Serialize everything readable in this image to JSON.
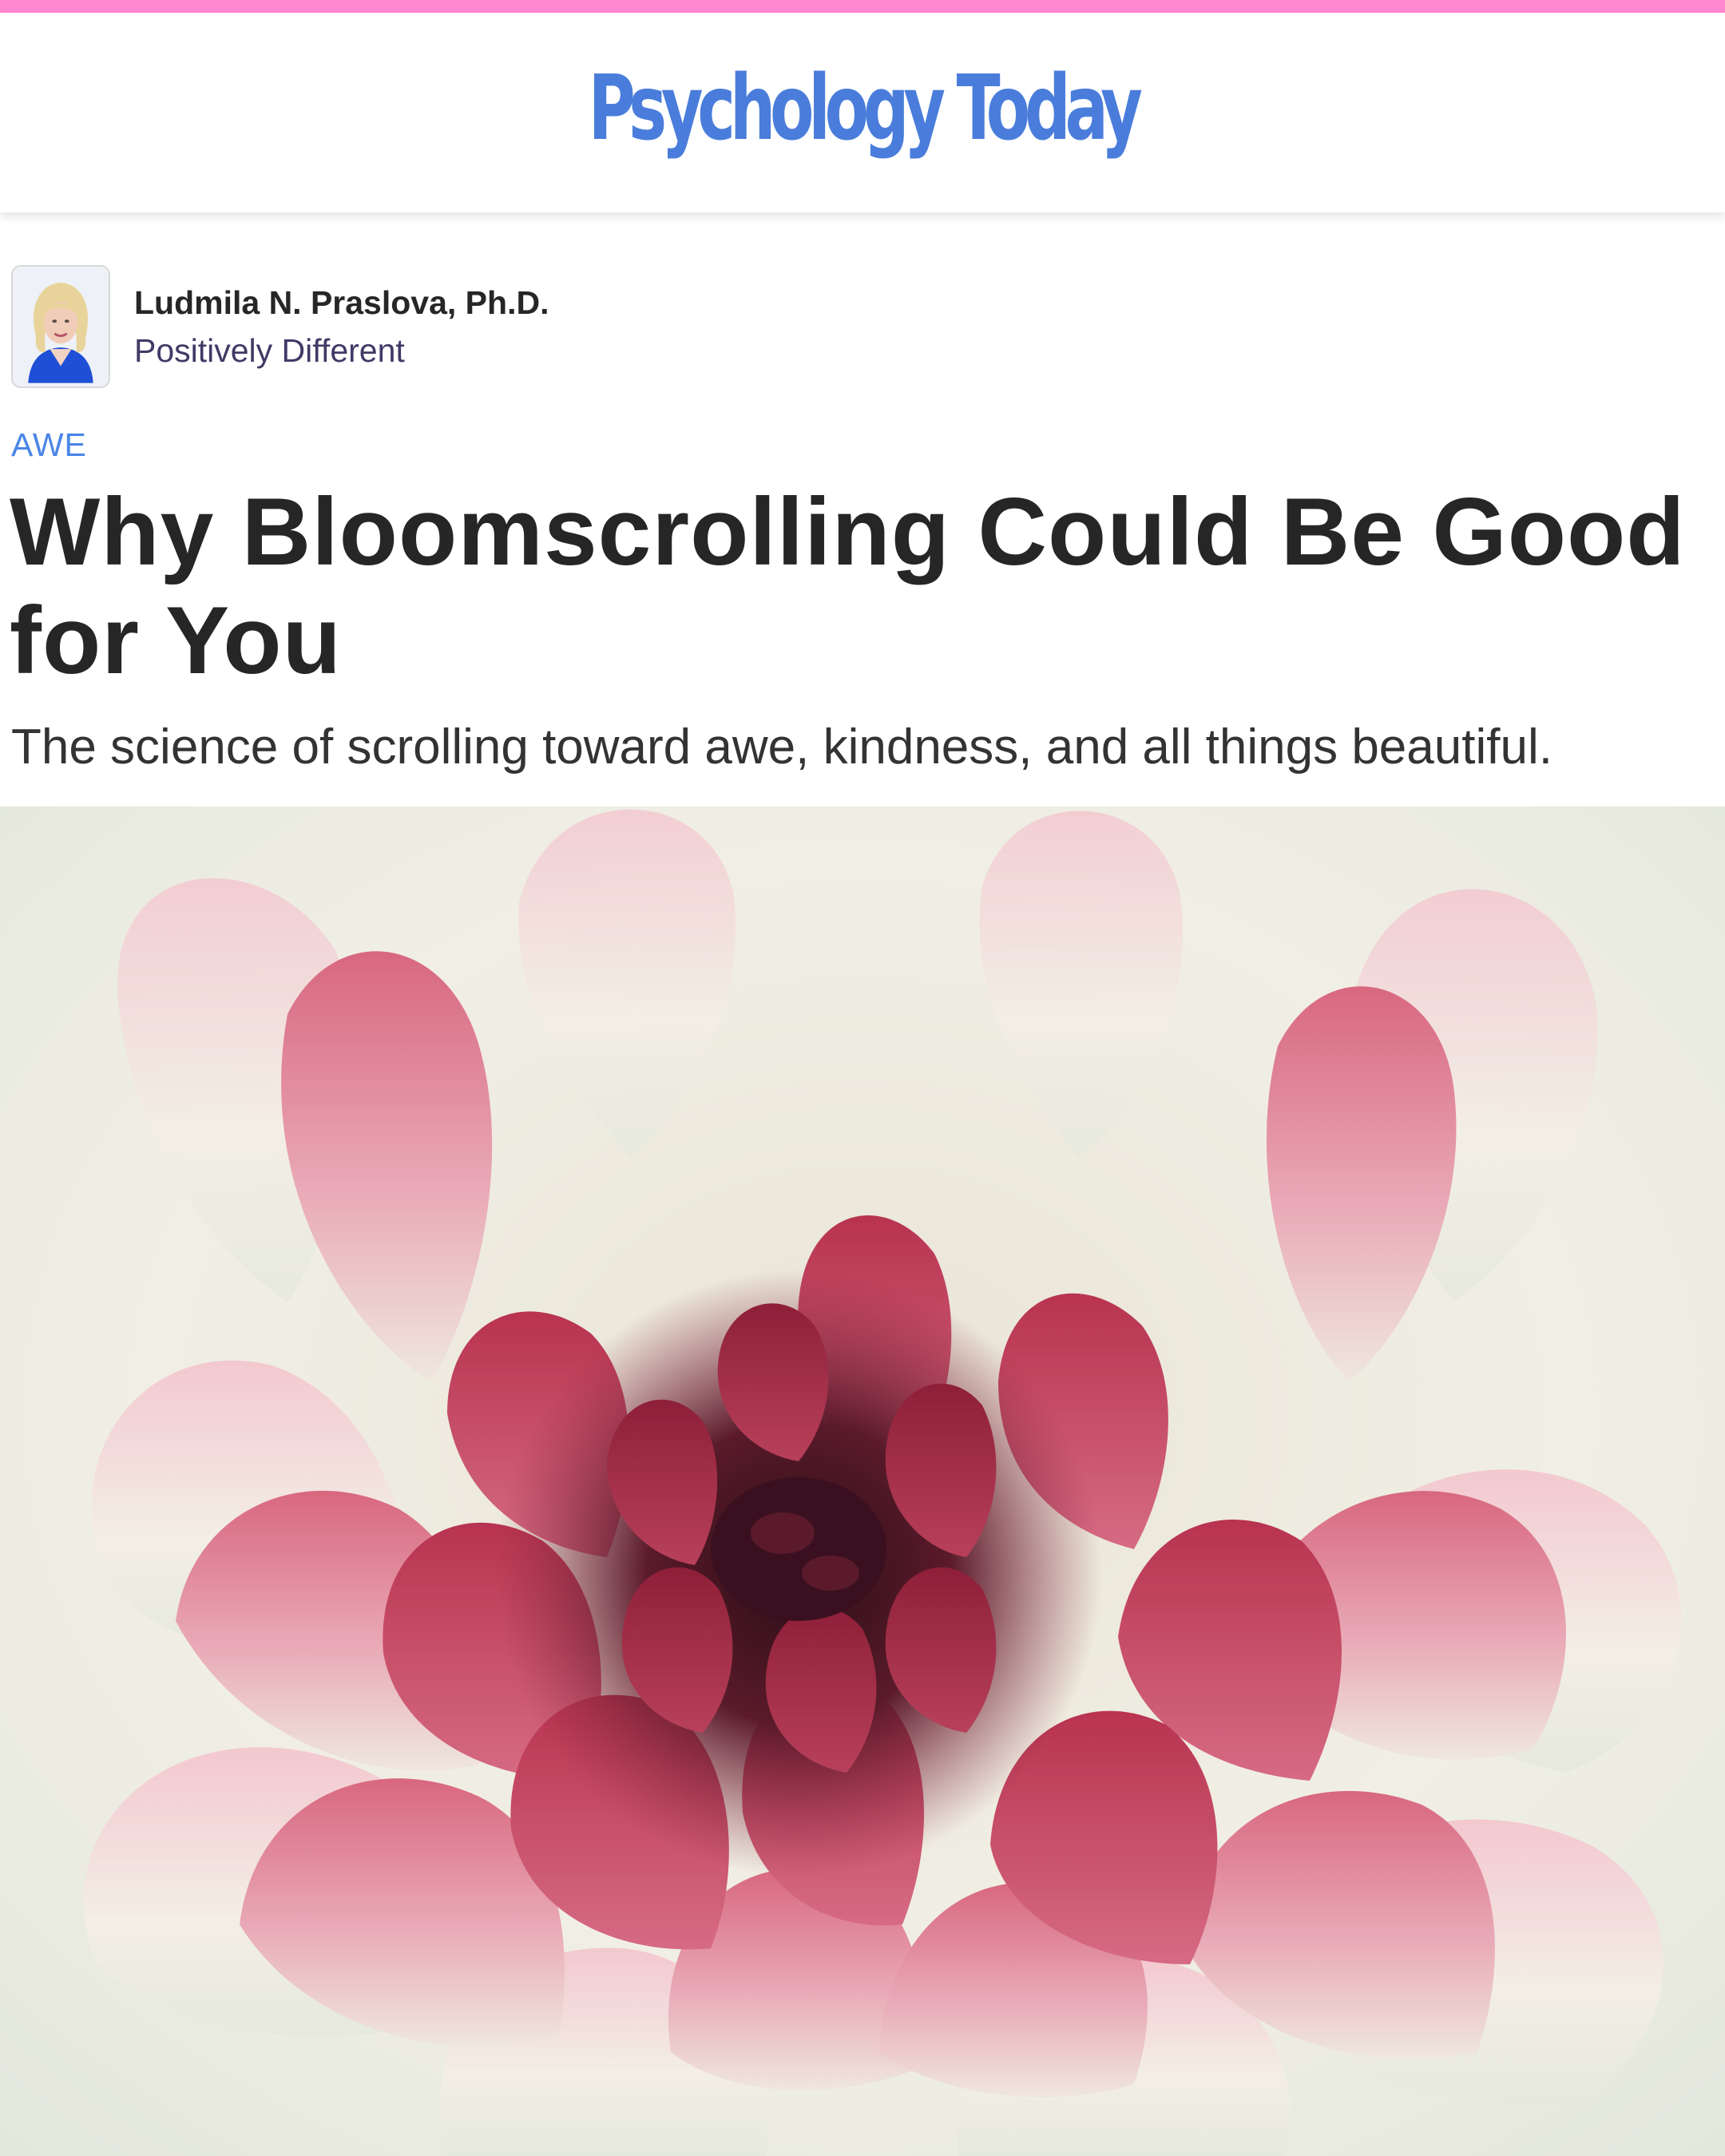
{
  "header": {
    "logo_text": "Psychology Today",
    "accent_color": "#ff88d0",
    "logo_color": "#4a7ddb"
  },
  "author": {
    "name": "Ludmila N. Praslova, Ph.D.",
    "blog": "Positively Different"
  },
  "article": {
    "tag": "AWE",
    "title": "Why Bloomscrolling Could Be Good for You",
    "subtitle": "The science of scrolling toward awe, kindness, and all things beautiful."
  },
  "hero_image": {
    "subject": "pink-dahlia-flower"
  }
}
